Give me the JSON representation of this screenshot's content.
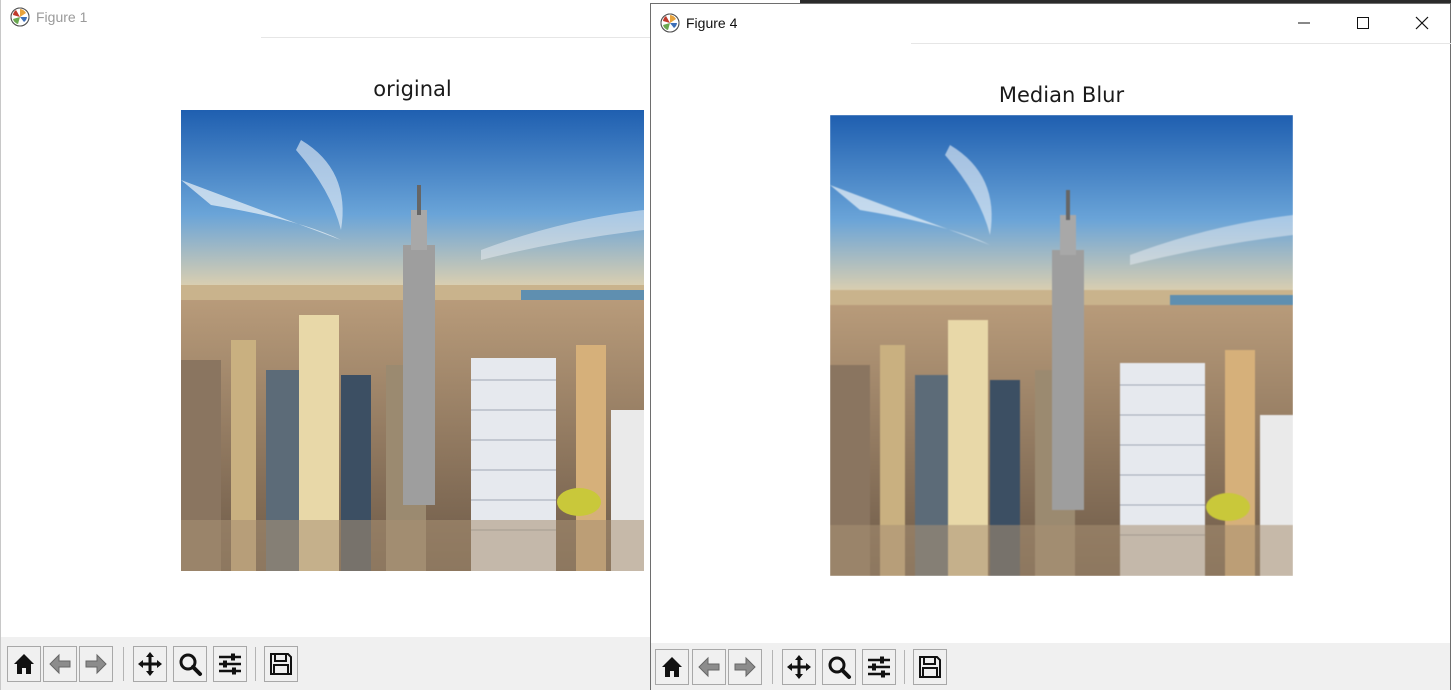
{
  "windows": [
    {
      "id": "win1",
      "title": "Figure 1",
      "plot_title": "original"
    },
    {
      "id": "win4",
      "title": "Figure 4",
      "plot_title": "Median Blur",
      "caption_buttons": [
        "minimize-icon",
        "maximize-icon",
        "close-icon"
      ]
    }
  ],
  "toolbar_icons": [
    "home-icon",
    "back-arrow-icon",
    "forward-arrow-icon",
    "pan-move-icon",
    "zoom-magnifier-icon",
    "configure-subplots-icon",
    "save-floppy-icon"
  ],
  "colors": {
    "toolbar_bg": "#f0f0f0",
    "window_bg": "#ffffff",
    "active_border": "#6e6e6e"
  }
}
